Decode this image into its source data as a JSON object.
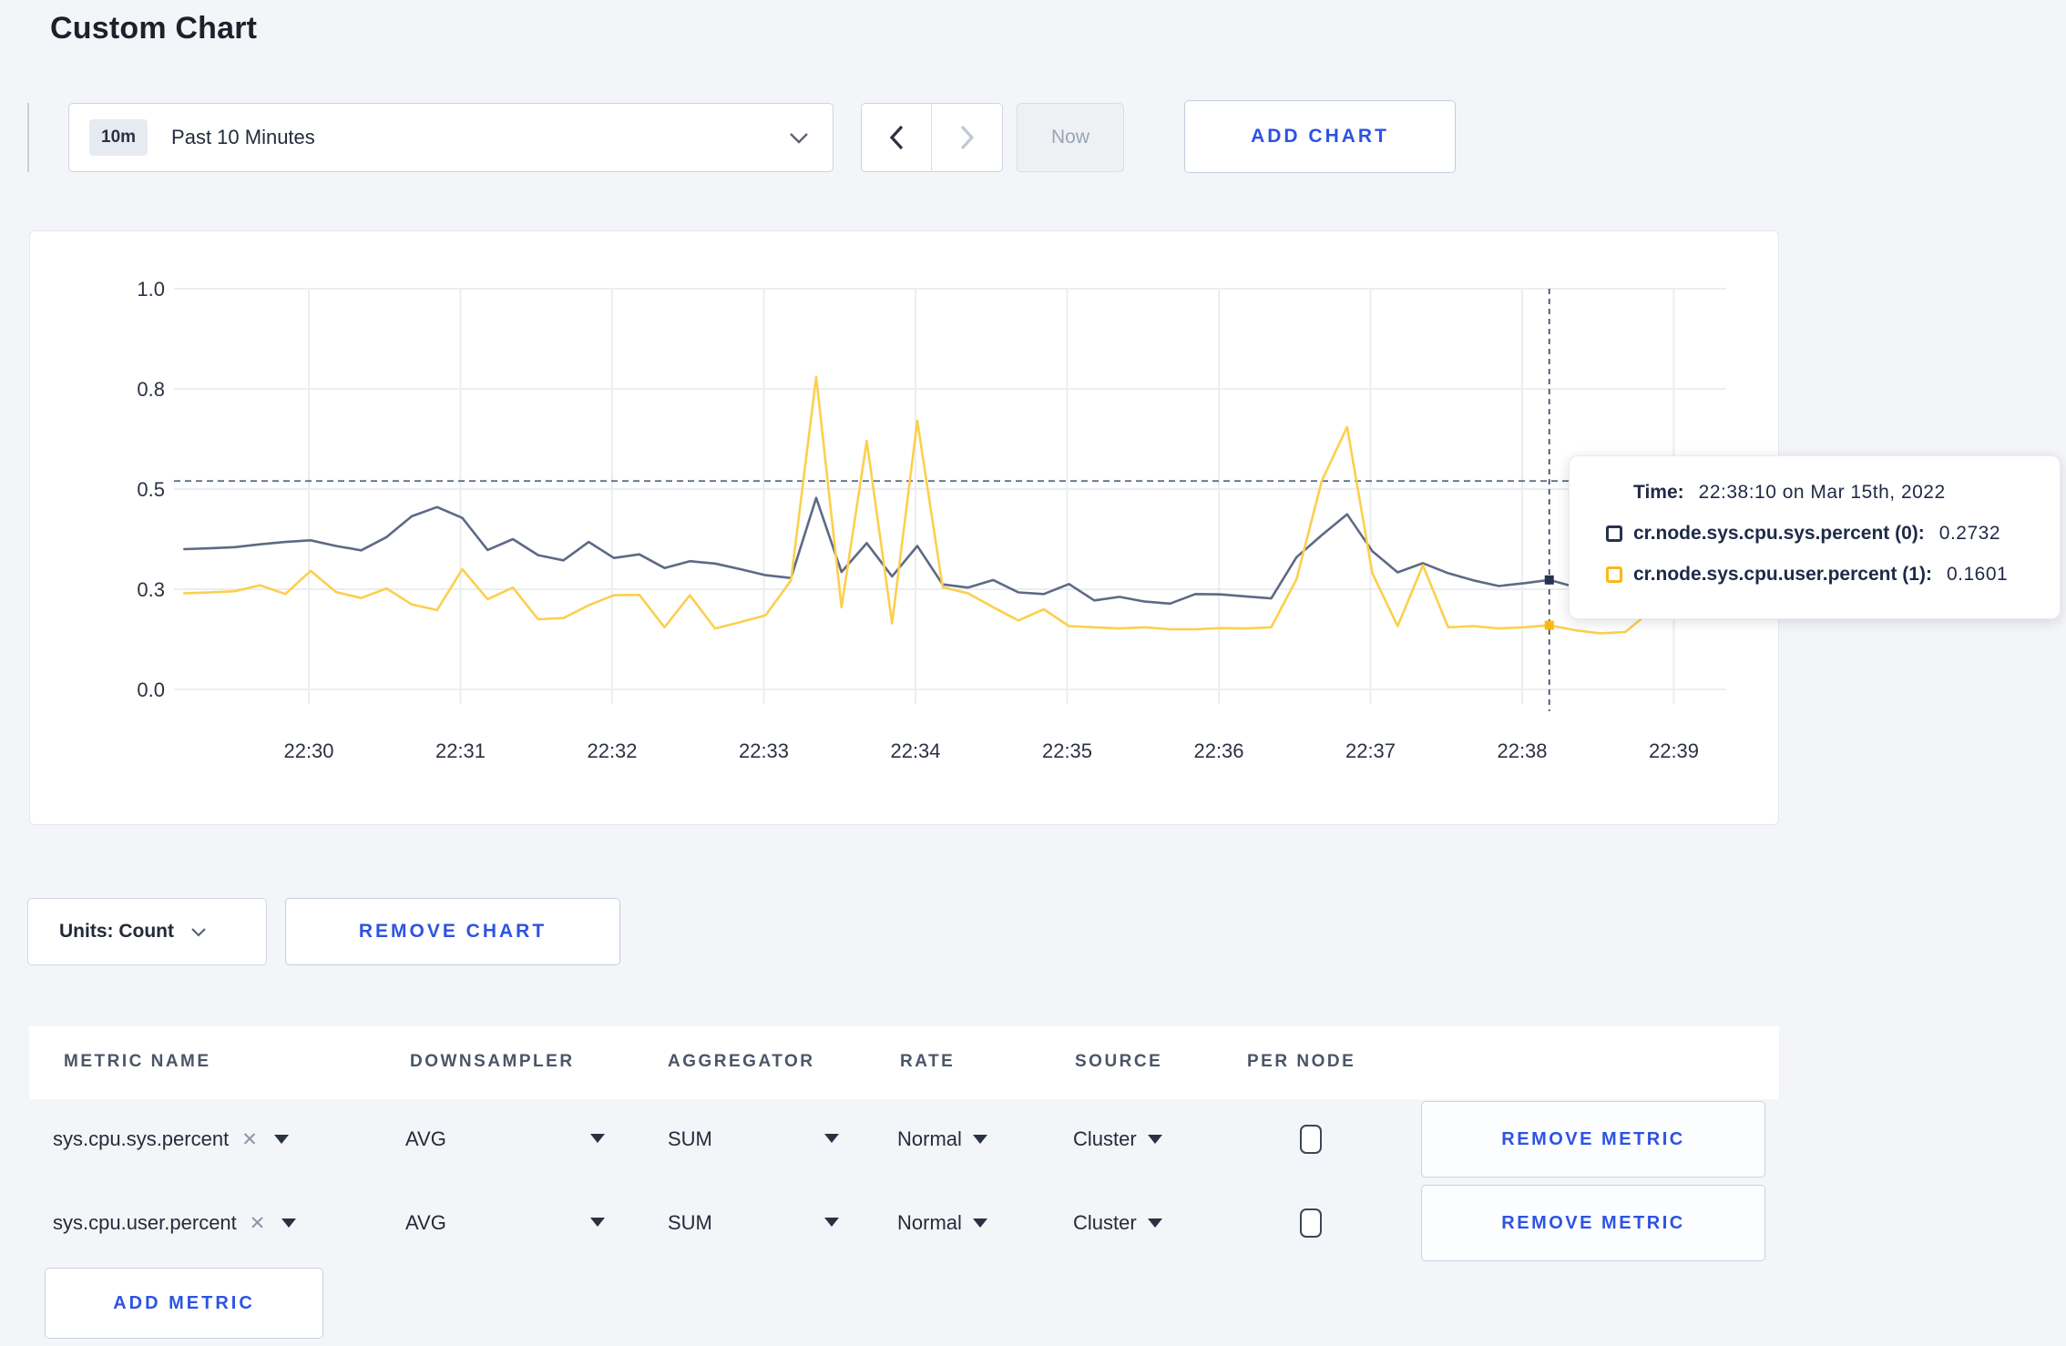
{
  "page": {
    "title": "Custom Chart",
    "background": "#f4f5f8",
    "accent_blue": "#2d53e3"
  },
  "toolbar": {
    "time_range_badge": "10m",
    "time_range_label": "Past 10 Minutes",
    "now_label": "Now",
    "add_chart_label": "ADD CHART"
  },
  "chart_data": {
    "type": "line",
    "units": "Count",
    "grid": true,
    "legend_position": "tooltip-only",
    "ylim": [
      0,
      1
    ],
    "y_ticks": [
      {
        "value": 1.0,
        "label": "1.0"
      },
      {
        "value": 0.75,
        "label": "0.8"
      },
      {
        "value": 0.5,
        "label": "0.5"
      },
      {
        "value": 0.25,
        "label": "0.3"
      },
      {
        "value": 0.0,
        "label": "0.0"
      }
    ],
    "x_ticks": [
      "22:30",
      "22:31",
      "22:32",
      "22:33",
      "22:34",
      "22:35",
      "22:36",
      "22:37",
      "22:38",
      "22:39"
    ],
    "x_start": "22:29:10",
    "x_step_seconds": 10,
    "series": [
      {
        "name": "cr.node.sys.cpu.sys.percent",
        "node": "(0)",
        "color": "#5d6a84",
        "marker_color": "#26334f",
        "values": [
          0.35,
          0.352,
          0.355,
          0.362,
          0.368,
          0.372,
          0.358,
          0.347,
          0.38,
          0.432,
          0.455,
          0.428,
          0.348,
          0.375,
          0.335,
          0.322,
          0.368,
          0.328,
          0.337,
          0.303,
          0.32,
          0.314,
          0.3,
          0.285,
          0.278,
          0.478,
          0.293,
          0.365,
          0.282,
          0.358,
          0.262,
          0.254,
          0.273,
          0.242,
          0.238,
          0.263,
          0.222,
          0.231,
          0.219,
          0.214,
          0.238,
          0.237,
          0.232,
          0.227,
          0.33,
          0.385,
          0.437,
          0.345,
          0.292,
          0.315,
          0.29,
          0.272,
          0.258,
          0.265,
          0.2732,
          0.256,
          0.268,
          0.285,
          0.292,
          0.305,
          0.3,
          0.285
        ]
      },
      {
        "name": "cr.node.sys.cpu.user.percent",
        "node": "(1)",
        "color": "#fccf4d",
        "marker_color": "#fdb713",
        "values": [
          0.24,
          0.242,
          0.245,
          0.26,
          0.238,
          0.296,
          0.243,
          0.228,
          0.252,
          0.212,
          0.198,
          0.3,
          0.225,
          0.254,
          0.175,
          0.178,
          0.21,
          0.235,
          0.236,
          0.155,
          0.235,
          0.152,
          0.168,
          0.185,
          0.272,
          0.78,
          0.205,
          0.62,
          0.165,
          0.67,
          0.255,
          0.24,
          0.205,
          0.172,
          0.2,
          0.158,
          0.155,
          0.152,
          0.155,
          0.15,
          0.15,
          0.153,
          0.152,
          0.155,
          0.275,
          0.52,
          0.655,
          0.29,
          0.158,
          0.31,
          0.155,
          0.158,
          0.152,
          0.155,
          0.1601,
          0.148,
          0.14,
          0.143,
          0.195,
          0.282,
          0.268,
          0.238
        ]
      }
    ],
    "crosshair": {
      "time": "22:38:10",
      "h_value": 0.52
    }
  },
  "tooltip": {
    "time_label": "Time:",
    "time_value": "22:38:10 on Mar 15th, 2022",
    "rows": [
      {
        "label": "cr.node.sys.cpu.sys.percent (0):",
        "value": "0.2732",
        "color": "#26334f"
      },
      {
        "label": "cr.node.sys.cpu.user.percent (1):",
        "value": "0.1601",
        "color": "#fdb713"
      }
    ]
  },
  "chart_controls": {
    "units_label": "Units: Count",
    "remove_chart_label": "REMOVE CHART"
  },
  "metrics_table": {
    "headers": [
      "METRIC NAME",
      "DOWNSAMPLER",
      "AGGREGATOR",
      "RATE",
      "SOURCE",
      "PER NODE"
    ],
    "remove_metric_label": "REMOVE METRIC",
    "add_metric_label": "ADD METRIC",
    "clear_icon": "✕",
    "rows": [
      {
        "metric": "sys.cpu.sys.percent",
        "downsampler": "AVG",
        "aggregator": "SUM",
        "rate": "Normal",
        "source": "Cluster",
        "per_node_checked": false
      },
      {
        "metric": "sys.cpu.user.percent",
        "downsampler": "AVG",
        "aggregator": "SUM",
        "rate": "Normal",
        "source": "Cluster",
        "per_node_checked": false
      }
    ]
  }
}
